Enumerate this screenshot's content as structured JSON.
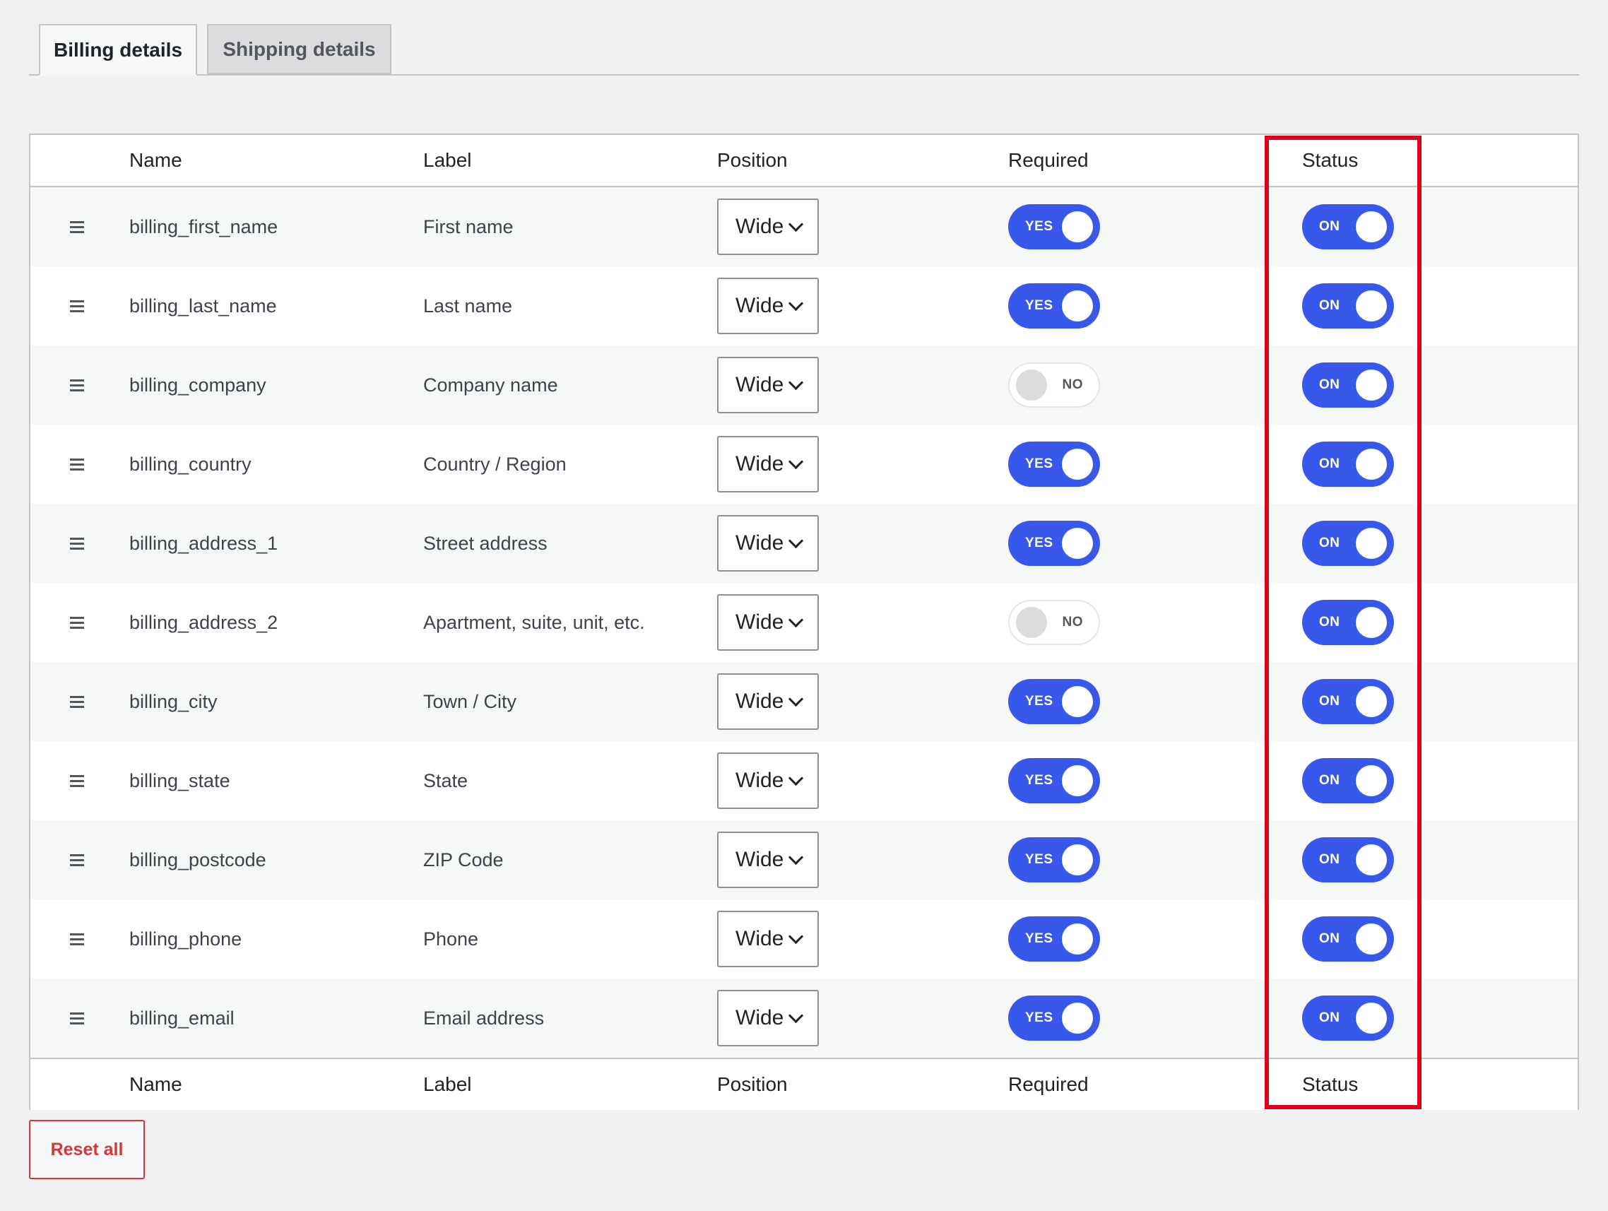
{
  "tabs": [
    {
      "label": "Billing details",
      "active": true
    },
    {
      "label": "Shipping details",
      "active": false
    }
  ],
  "table": {
    "headers": {
      "name": "Name",
      "label": "Label",
      "position": "Position",
      "required": "Required",
      "status": "Status"
    },
    "rows": [
      {
        "name": "billing_first_name",
        "label": "First name",
        "position": "Wide",
        "required": "YES",
        "status": "ON"
      },
      {
        "name": "billing_last_name",
        "label": "Last name",
        "position": "Wide",
        "required": "YES",
        "status": "ON"
      },
      {
        "name": "billing_company",
        "label": "Company name",
        "position": "Wide",
        "required": "NO",
        "status": "ON"
      },
      {
        "name": "billing_country",
        "label": "Country / Region",
        "position": "Wide",
        "required": "YES",
        "status": "ON"
      },
      {
        "name": "billing_address_1",
        "label": "Street address",
        "position": "Wide",
        "required": "YES",
        "status": "ON"
      },
      {
        "name": "billing_address_2",
        "label": "Apartment, suite, unit, etc.",
        "position": "Wide",
        "required": "NO",
        "status": "ON"
      },
      {
        "name": "billing_city",
        "label": "Town / City",
        "position": "Wide",
        "required": "YES",
        "status": "ON"
      },
      {
        "name": "billing_state",
        "label": "State",
        "position": "Wide",
        "required": "YES",
        "status": "ON"
      },
      {
        "name": "billing_postcode",
        "label": "ZIP Code",
        "position": "Wide",
        "required": "YES",
        "status": "ON"
      },
      {
        "name": "billing_phone",
        "label": "Phone",
        "position": "Wide",
        "required": "YES",
        "status": "ON"
      },
      {
        "name": "billing_email",
        "label": "Email address",
        "position": "Wide",
        "required": "YES",
        "status": "ON"
      }
    ]
  },
  "reset_label": "Reset all",
  "colors": {
    "toggle_on": "#3858e9",
    "toggle_off": "#dcdcde",
    "highlight": "#e0001b",
    "reset": "#d63638"
  }
}
